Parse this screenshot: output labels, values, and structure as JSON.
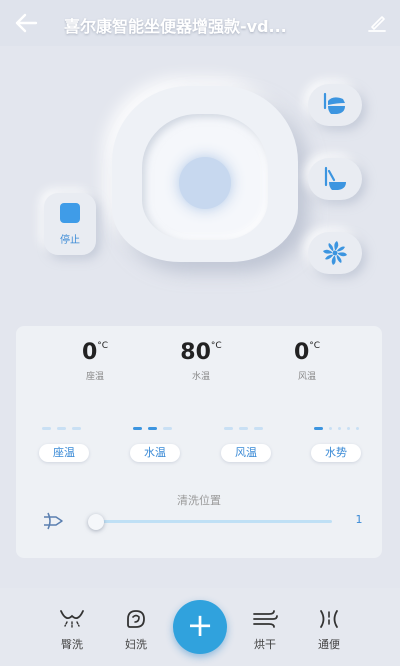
{
  "header": {
    "back_icon": "arrow-left-icon",
    "title": "喜尔康智能坐便器增强款-vd...",
    "edit_icon": "pencil-icon"
  },
  "device": {
    "stop_label": "停止",
    "side_buttons": [
      {
        "icon": "lid-open-icon"
      },
      {
        "icon": "seat-open-icon"
      },
      {
        "icon": "fan-icon"
      }
    ]
  },
  "readings": [
    {
      "value": "0",
      "unit": "°C",
      "label": "座温"
    },
    {
      "value": "80",
      "unit": "°C",
      "label": "水温"
    },
    {
      "value": "0",
      "unit": "°C",
      "label": "风温"
    }
  ],
  "settings": [
    {
      "label": "座温",
      "level": 0,
      "max": 3
    },
    {
      "label": "水温",
      "level": 2,
      "max": 3
    },
    {
      "label": "风温",
      "level": 0,
      "max": 3
    },
    {
      "label": "水势",
      "level": 1,
      "max": 5
    }
  ],
  "wash_position": {
    "label": "清洗位置",
    "icon": "nozzle-position-icon",
    "value": "1",
    "fraction": 0.0
  },
  "bottom_nav": {
    "items": [
      {
        "label": "臀洗",
        "icon": "hip-wash-icon"
      },
      {
        "label": "妇洗",
        "icon": "feminine-wash-icon"
      },
      {
        "label": "烘干",
        "icon": "dry-icon"
      },
      {
        "label": "通便",
        "icon": "enema-icon"
      }
    ],
    "add_label": "+",
    "accent": "#30a2dd"
  },
  "colors": {
    "accent_blue": "#3c95e0",
    "background": "#e3e6ee"
  }
}
